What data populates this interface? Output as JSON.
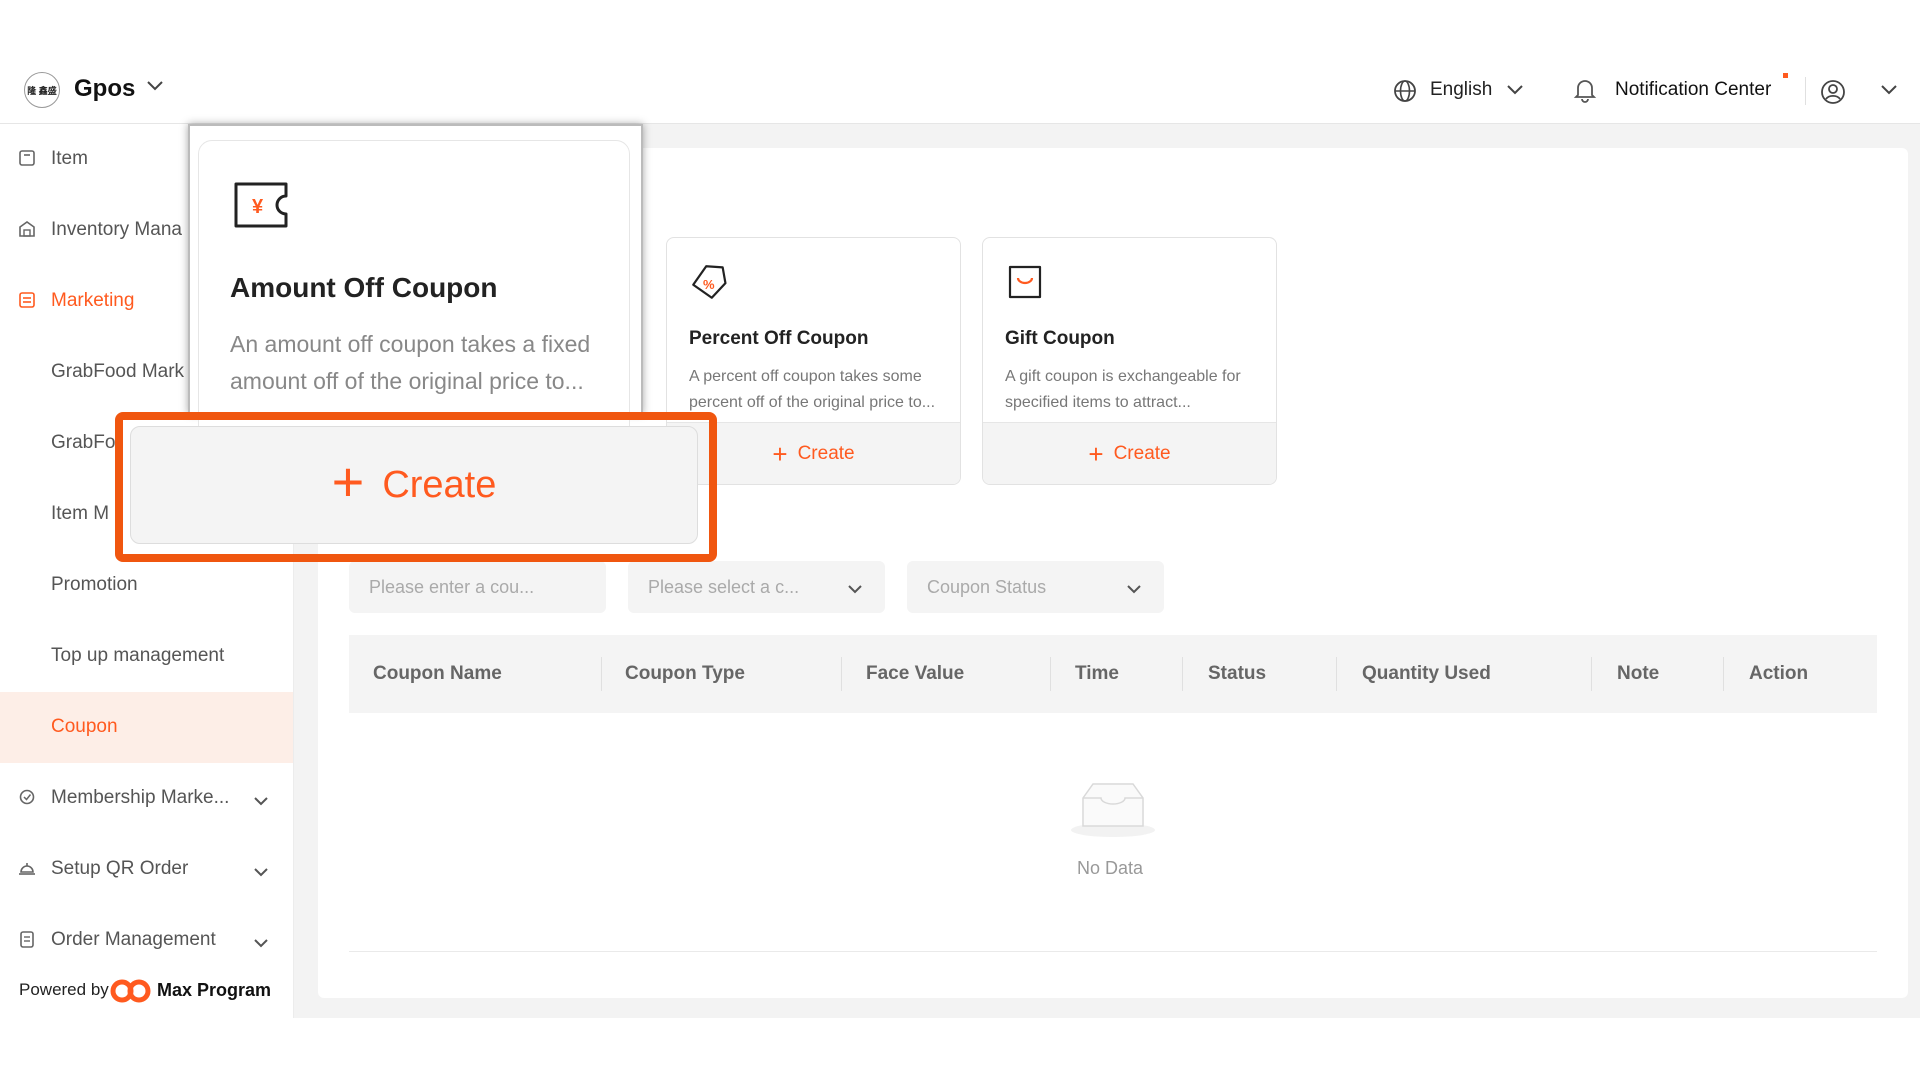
{
  "header": {
    "brand": "Gpos",
    "logo_text": "隆 鑫盛",
    "language": "English",
    "notification": "Notification Center"
  },
  "sidebar": {
    "items": [
      {
        "label": "Item"
      },
      {
        "label": "Inventory Mana"
      },
      {
        "label": "Marketing"
      },
      {
        "label": "GrabFood Mark"
      },
      {
        "label": "GrabFo"
      },
      {
        "label": "Item M"
      },
      {
        "label": "Promotion"
      },
      {
        "label": "Top up management"
      },
      {
        "label": "Coupon"
      },
      {
        "label": "Membership Marke..."
      },
      {
        "label": "Setup QR Order"
      },
      {
        "label": "Order Management"
      }
    ],
    "powered_by": "Powered by",
    "program": "Max Program"
  },
  "coupon_cards": [
    {
      "title": "Amount Off Coupon",
      "description": "An amount off coupon takes a fixed amount off of the original price to...",
      "button": "Create"
    },
    {
      "title": "Percent Off Coupon",
      "description": "A percent off coupon takes some percent off of the original price to...",
      "button": "Create"
    },
    {
      "title": "Gift Coupon",
      "description": "A gift coupon is exchangeable for specified items to attract...",
      "button": "Create"
    }
  ],
  "filters": {
    "name_placeholder": "Please enter a cou...",
    "type_placeholder": "Please select a c...",
    "status_placeholder": "Coupon Status"
  },
  "table": {
    "columns": [
      "Coupon Name",
      "Coupon Type",
      "Face Value",
      "Time",
      "Status",
      "Quantity Used",
      "Note",
      "Action"
    ],
    "empty_text": "No Data"
  },
  "colors": {
    "accent": "#ff5a1f",
    "highlight": "#f0560f",
    "selected_bg": "#fdeee7"
  }
}
